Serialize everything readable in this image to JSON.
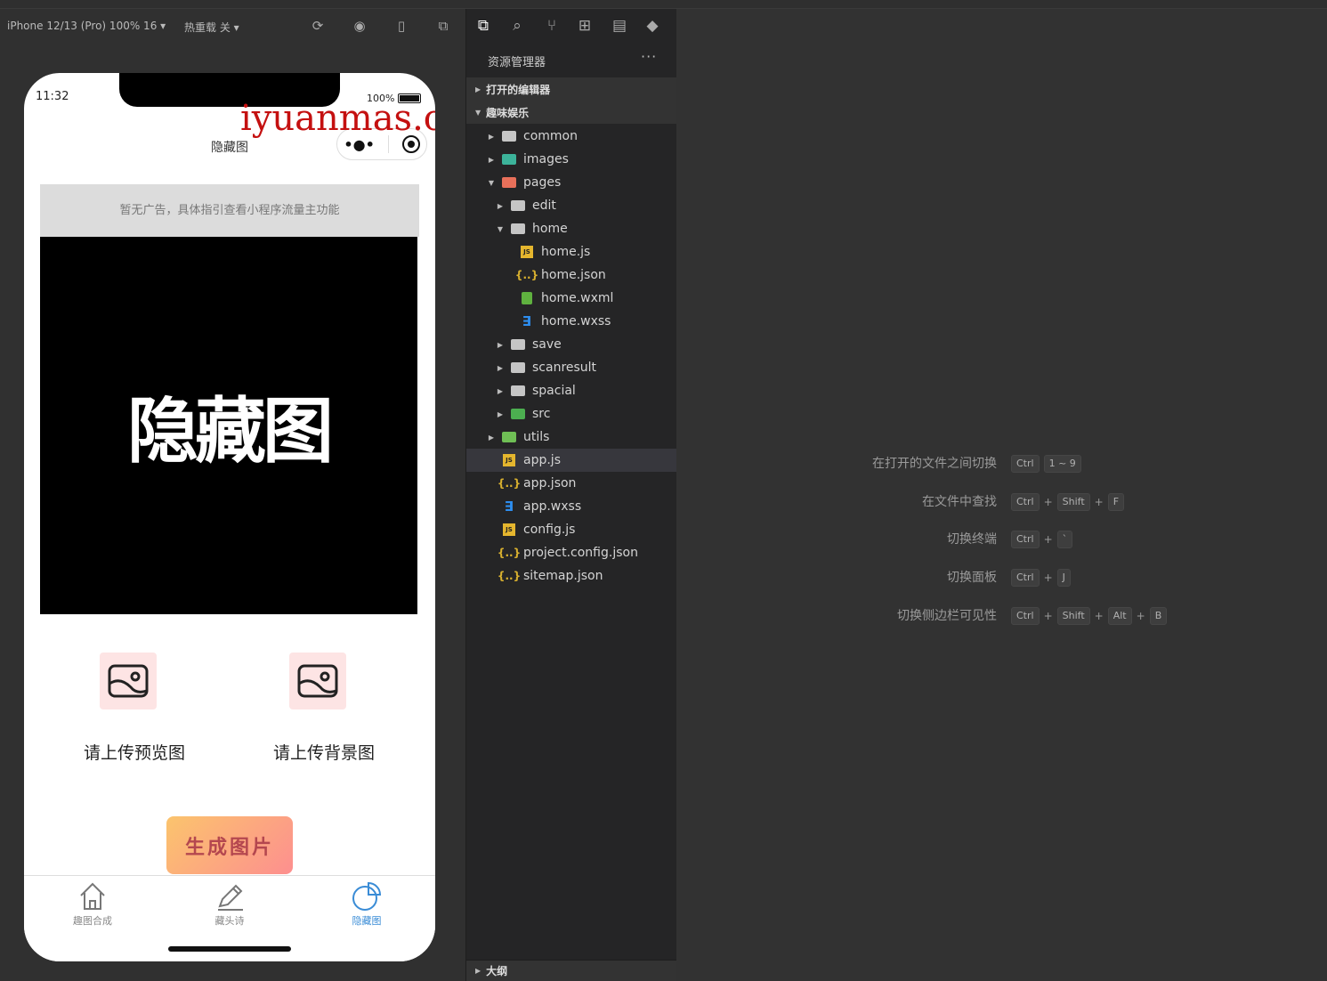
{
  "simulator": {
    "device_label": "iPhone 12/13 (Pro) 100% 16 ▾",
    "hot_reload_label": "热重载 关 ▾"
  },
  "phone": {
    "time": "11:32",
    "battery": "100%",
    "nav_title": "隐藏图",
    "watermark": "iyuanmas.com",
    "ad_text": "暂无广告，具体指引查看小程序流量主功能",
    "preview_image_text": "隐藏图",
    "upload_preview_label": "请上传预览图",
    "upload_background_label": "请上传背景图",
    "generate_button": "生成图片",
    "tabs": [
      {
        "label": "趣图合成",
        "icon": "home-icon"
      },
      {
        "label": "藏头诗",
        "icon": "pen-icon"
      },
      {
        "label": "隐藏图",
        "icon": "pie-chart-icon"
      }
    ],
    "active_color": "#3a8cd6"
  },
  "explorer": {
    "title": "资源管理器",
    "more": "···",
    "open_editors": "打开的编辑器",
    "project": "趣味娱乐",
    "outline": "大纲",
    "tree": [
      {
        "name": "common",
        "type": "folder",
        "depth": 0
      },
      {
        "name": "images",
        "type": "folder-img",
        "depth": 0
      },
      {
        "name": "pages",
        "type": "folder-pages",
        "depth": 0,
        "open": true
      },
      {
        "name": "edit",
        "type": "folder",
        "depth": 1
      },
      {
        "name": "home",
        "type": "folder",
        "depth": 1,
        "open": true
      },
      {
        "name": "home.js",
        "type": "js",
        "depth": 2
      },
      {
        "name": "home.json",
        "type": "json",
        "depth": 2
      },
      {
        "name": "home.wxml",
        "type": "wxml",
        "depth": 2
      },
      {
        "name": "home.wxss",
        "type": "wxss",
        "depth": 2
      },
      {
        "name": "save",
        "type": "folder",
        "depth": 1
      },
      {
        "name": "scanresult",
        "type": "folder",
        "depth": 1
      },
      {
        "name": "spacial",
        "type": "folder",
        "depth": 1
      },
      {
        "name": "src",
        "type": "folder-src",
        "depth": 1
      },
      {
        "name": "utils",
        "type": "folder-utils",
        "depth": 0
      },
      {
        "name": "app.js",
        "type": "js",
        "depth": 0,
        "selected": true
      },
      {
        "name": "app.json",
        "type": "json",
        "depth": 0
      },
      {
        "name": "app.wxss",
        "type": "wxss",
        "depth": 0
      },
      {
        "name": "config.js",
        "type": "js",
        "depth": 0
      },
      {
        "name": "project.config.json",
        "type": "json",
        "depth": 0
      },
      {
        "name": "sitemap.json",
        "type": "json",
        "depth": 0
      }
    ]
  },
  "shortcuts": [
    {
      "label": "在打开的文件之间切换",
      "keys": [
        "Ctrl",
        "1 ~ 9"
      ]
    },
    {
      "label": "在文件中查找",
      "keys": [
        "Ctrl",
        "+",
        "Shift",
        "+",
        "F"
      ]
    },
    {
      "label": "切换终端",
      "keys": [
        "Ctrl",
        "+",
        "`"
      ]
    },
    {
      "label": "切换面板",
      "keys": [
        "Ctrl",
        "+",
        "J"
      ]
    },
    {
      "label": "切换侧边栏可见性",
      "keys": [
        "Ctrl",
        "+",
        "Shift",
        "+",
        "Alt",
        "+",
        "B"
      ]
    }
  ]
}
